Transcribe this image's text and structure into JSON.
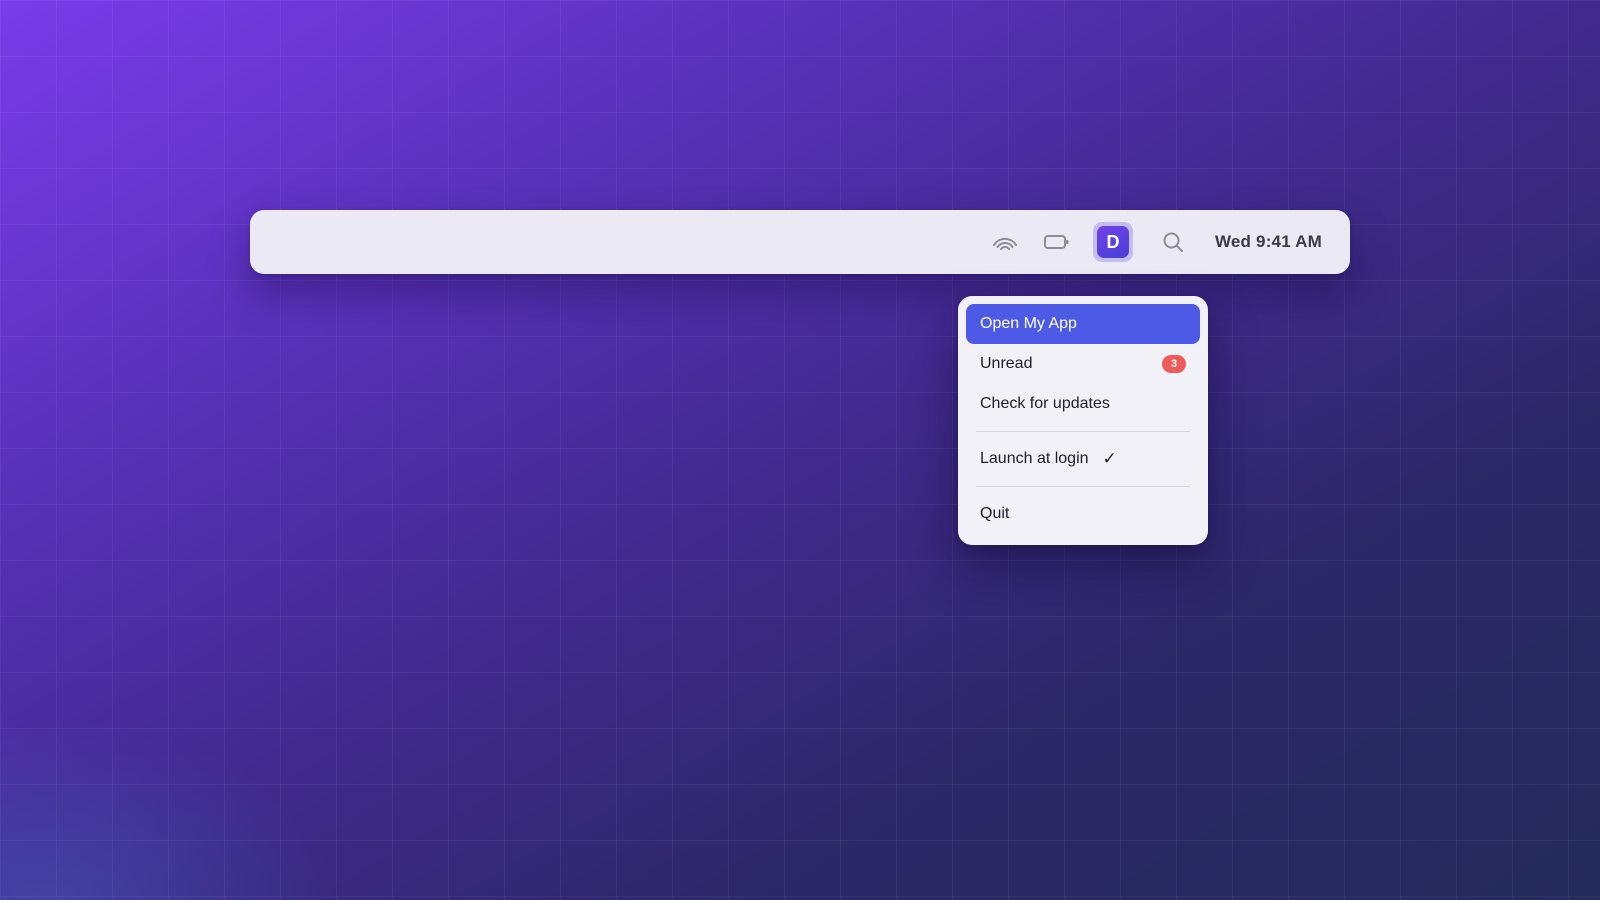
{
  "desktop": {
    "background_colors": [
      "#7a3cea",
      "#412a8f",
      "#242a5a"
    ]
  },
  "menubar": {
    "clock": "Wed 9:41 AM",
    "tray_icons": [
      "wifi-icon",
      "battery-icon",
      "app-d-icon",
      "search-icon"
    ],
    "app_icon_letter": "D",
    "accent": "#5b45e0"
  },
  "menu": {
    "items": [
      {
        "label": "Open My App",
        "highlighted": true
      },
      {
        "label": "Unread",
        "badge": "3"
      },
      {
        "label": "Check for updates"
      },
      {
        "label": "Launch at login",
        "checked": true,
        "check_glyph": "✓"
      },
      {
        "label": "Quit"
      }
    ],
    "highlight_color": "#4c5ae6",
    "badge_color": "#ef5b5b"
  }
}
